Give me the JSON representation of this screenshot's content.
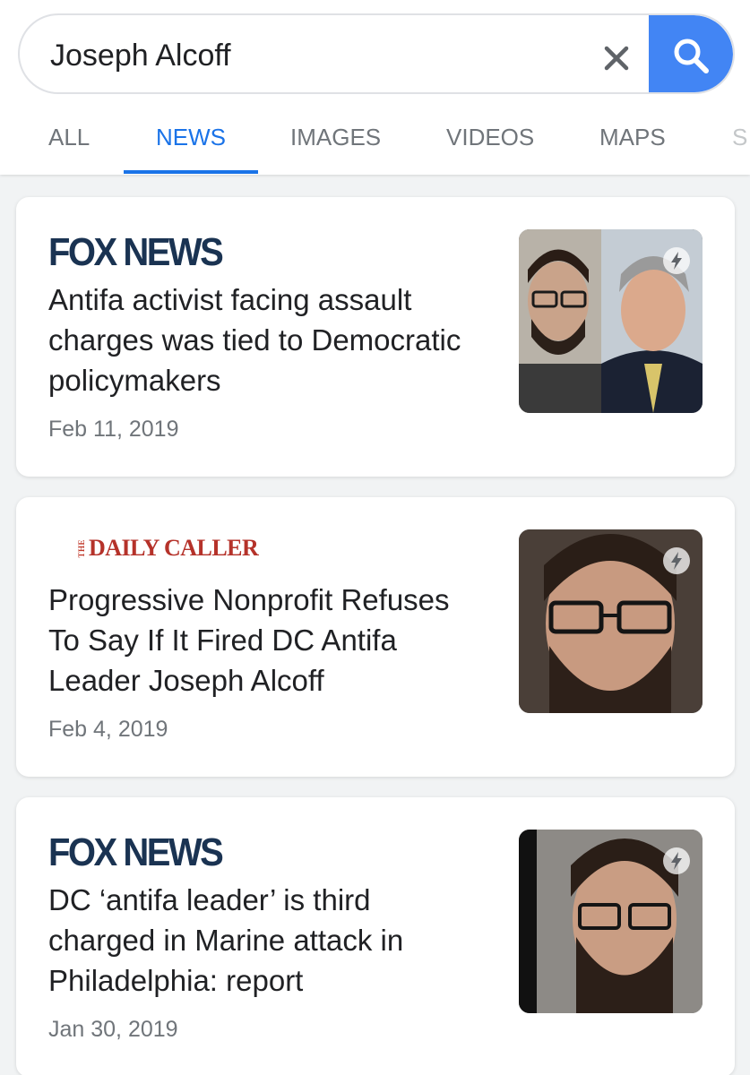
{
  "search": {
    "query": "Joseph Alcoff",
    "clear_icon": "close-icon",
    "search_icon": "search-icon"
  },
  "tabs": [
    {
      "label": "ALL",
      "active": false
    },
    {
      "label": "NEWS",
      "active": true
    },
    {
      "label": "IMAGES",
      "active": false
    },
    {
      "label": "VIDEOS",
      "active": false
    },
    {
      "label": "MAPS",
      "active": false
    },
    {
      "label": "S",
      "active": false
    }
  ],
  "colors": {
    "accent": "#1a73e8",
    "search_button": "#4285f4",
    "fox_logo": "#1a3352",
    "daily_caller_logo": "#b5322a"
  },
  "results": [
    {
      "source": "FOX NEWS",
      "headline": "Antifa activist facing assault charges was tied to Democratic policymakers",
      "date": "Feb 11, 2019",
      "amp_icon": "lightning-icon"
    },
    {
      "source_prefix": "THE",
      "source": "DAILY CALLER",
      "headline": "Progressive Nonprofit Refuses To Say If It Fired DC Antifa Leader Joseph Alcoff",
      "date": "Feb 4, 2019",
      "amp_icon": "lightning-icon"
    },
    {
      "source": "FOX NEWS",
      "headline": "DC ‘antifa leader’ is third charged in Marine attack in Philadelphia: report",
      "date": "Jan 30, 2019",
      "amp_icon": "lightning-icon"
    }
  ]
}
